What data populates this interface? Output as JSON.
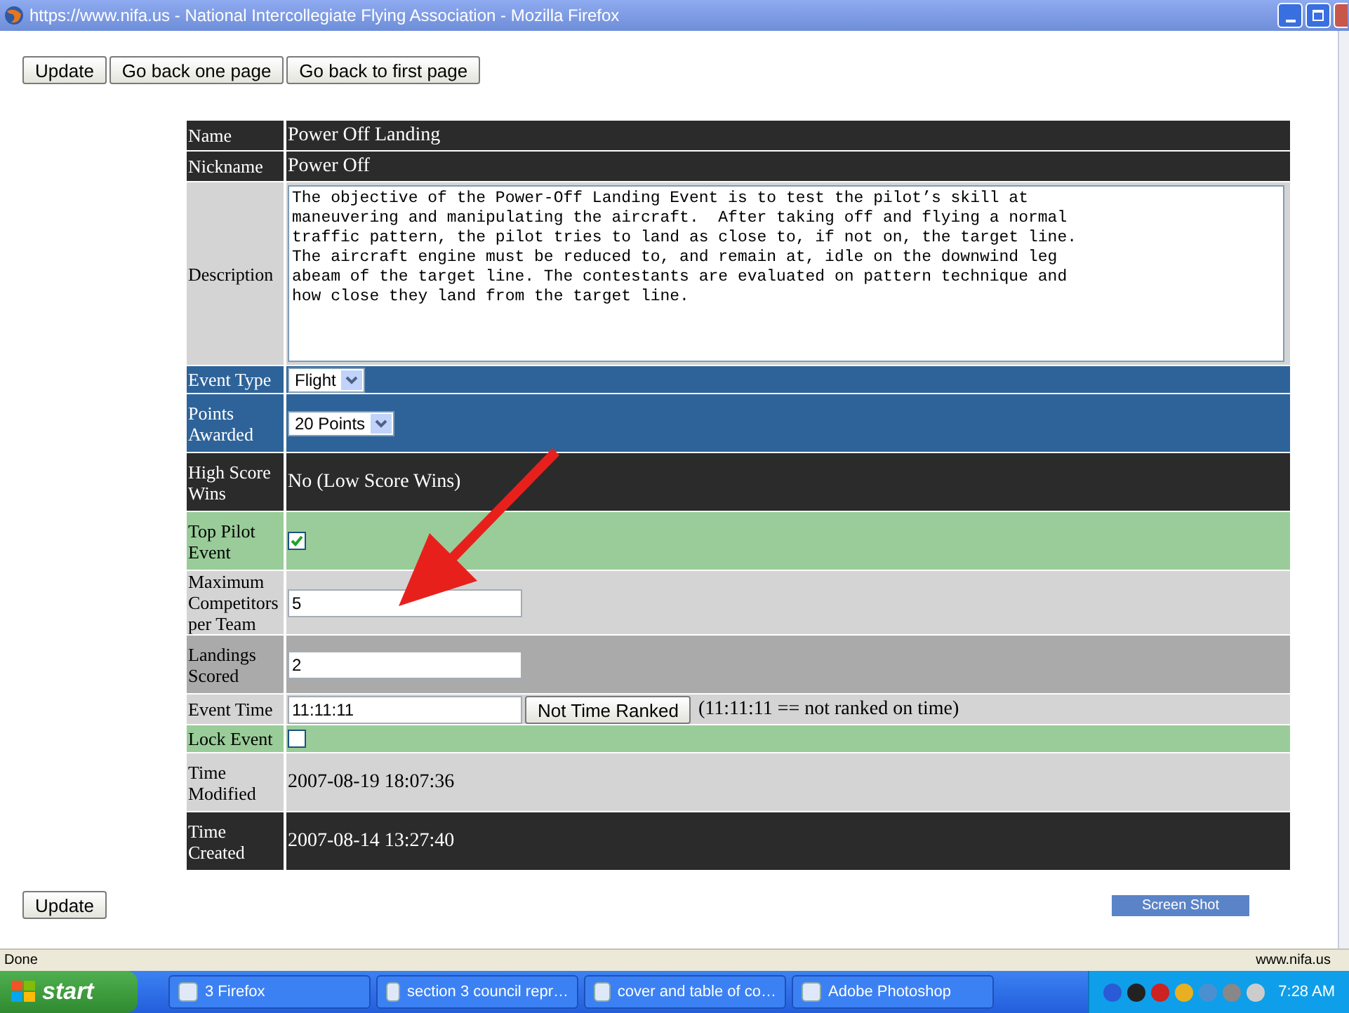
{
  "window": {
    "title": "https://www.nifa.us - National Intercollegiate Flying Association - Mozilla Firefox"
  },
  "top_buttons": [
    "Update",
    "Go back one page",
    "Go back to first page"
  ],
  "rows": [
    {
      "label": "Name",
      "kind": "text",
      "color": "#2b2b2b",
      "value": "Power Off Landing"
    },
    {
      "label": "Nickname",
      "kind": "text",
      "color": "#2b2b2b",
      "value": "Power Off"
    },
    {
      "label": "Description",
      "kind": "textarea",
      "color": "#d4d4d4",
      "value": "The objective of the Power-Off Landing Event is to test the pilot’s skill at\nmaneuvering and manipulating the aircraft.  After taking off and flying a normal\ntraffic pattern, the pilot tries to land as close to, if not on, the target line.\nThe aircraft engine must be reduced to, and remain at, idle on the downwind leg\nabeam of the target line. The contestants are evaluated on pattern technique and\nhow close they land from the target line."
    },
    {
      "label": "Event Type",
      "kind": "select",
      "color": "#2e6399",
      "value": "Flight"
    },
    {
      "label": "Points Awarded",
      "kind": "select",
      "color": "#2e6399",
      "value": "20 Points"
    },
    {
      "label": "High Score Wins",
      "kind": "text",
      "color": "#2b2b2b",
      "value": "No (Low Score Wins)"
    },
    {
      "label": "Top Pilot Event",
      "kind": "checkbox",
      "color": "#99cc99",
      "checked": true
    },
    {
      "label": "Maximum Competitors per Team",
      "kind": "input",
      "color": "#d4d4d4",
      "value": "5"
    },
    {
      "label": "Landings Scored",
      "kind": "input",
      "color": "#aaaaaa",
      "value": "2"
    },
    {
      "label": "Event Time",
      "kind": "input_button",
      "color": "#d4d4d4",
      "value": "11:11:11",
      "button": "Not Time Ranked",
      "note": "(11:11:11 == not ranked on time)"
    },
    {
      "label": "Lock Event",
      "kind": "checkbox",
      "color": "#99cc99",
      "checked": false
    },
    {
      "label": "Time Modified",
      "kind": "text",
      "color": "#d4d4d4",
      "value": "2007-08-19 18:07:36"
    },
    {
      "label": "Time Created",
      "kind": "text",
      "color": "#2b2b2b",
      "value": "2007-08-14 13:27:40"
    }
  ],
  "bottom_button": "Update",
  "screenshot_button": "Screen Shot",
  "status_bar": {
    "text": "Done",
    "url": "www.nifa.us"
  },
  "taskbar": {
    "start": "start",
    "tasks": [
      "3 Firefox",
      "section 3 council repr…",
      "cover and table of co…",
      "Adobe Photoshop"
    ],
    "clock": "7:28 AM"
  }
}
